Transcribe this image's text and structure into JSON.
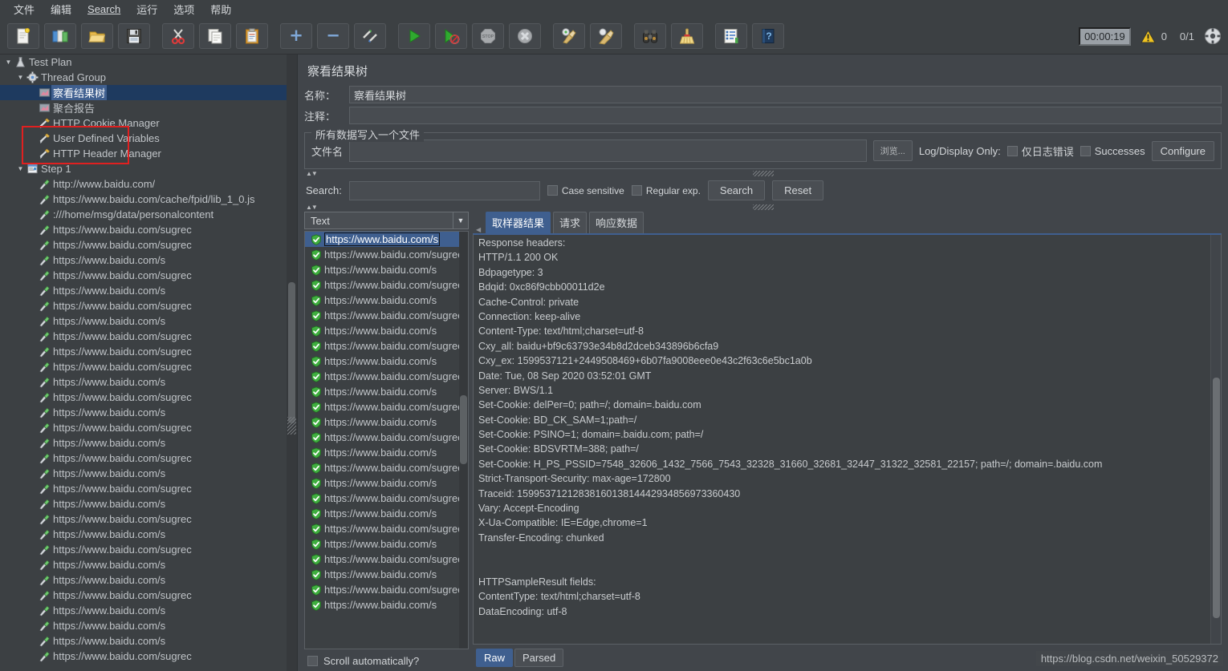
{
  "menu": {
    "items": [
      {
        "label": "文件",
        "name": "menu-file"
      },
      {
        "label": "编辑",
        "name": "menu-edit"
      },
      {
        "label": "Search",
        "name": "menu-search"
      },
      {
        "label": "运行",
        "name": "menu-run"
      },
      {
        "label": "选项",
        "name": "menu-options"
      },
      {
        "label": "帮助",
        "name": "menu-help"
      }
    ]
  },
  "toolbar": {
    "buttons": [
      {
        "icon": "new-document-icon",
        "name": "new-button"
      },
      {
        "icon": "open-templates-icon",
        "name": "templates-button"
      },
      {
        "icon": "open-folder-icon",
        "name": "open-button"
      },
      {
        "icon": "save-floppy-icon",
        "name": "save-button"
      },
      {
        "icon": "cut-scissors-icon",
        "name": "cut-button"
      },
      {
        "icon": "copy-icon",
        "name": "copy-button"
      },
      {
        "icon": "paste-clipboard-icon",
        "name": "paste-button"
      },
      {
        "icon": "plus-icon",
        "name": "expand-all-button"
      },
      {
        "icon": "minus-icon",
        "name": "collapse-all-button"
      },
      {
        "icon": "toggle-icon",
        "name": "toggle-button"
      },
      {
        "icon": "start-play-icon",
        "name": "start-button"
      },
      {
        "icon": "start-no-timers-icon",
        "name": "start-no-pauses-button"
      },
      {
        "icon": "stop-icon",
        "name": "stop-button"
      },
      {
        "icon": "shutdown-icon",
        "name": "shutdown-button"
      },
      {
        "icon": "clear-icon",
        "name": "clear-button"
      },
      {
        "icon": "clear-all-icon",
        "name": "clear-all-button"
      },
      {
        "icon": "binoculars-search-icon",
        "name": "search-tree-button"
      },
      {
        "icon": "broom-reset-icon",
        "name": "reset-search-button"
      },
      {
        "icon": "function-helper-icon",
        "name": "function-helper-button"
      },
      {
        "icon": "help-book-icon",
        "name": "help-button"
      }
    ],
    "status": {
      "timer": "00:00:19",
      "warning_icon": "warning-triangle-icon",
      "warning_count": "0",
      "thread_count": "0/1",
      "remote_icon": "thread-status-icon"
    }
  },
  "tree": {
    "nodes": [
      {
        "label": "Test Plan",
        "icon": "test-plan-icon",
        "depth": 0,
        "toggle": "down",
        "selected": false
      },
      {
        "label": "Thread Group",
        "icon": "thread-group-icon",
        "depth": 1,
        "toggle": "down",
        "selected": false
      },
      {
        "label": "察看结果树",
        "icon": "view-results-tree-icon",
        "depth": 2,
        "toggle": "none",
        "selected": true
      },
      {
        "label": "聚合报告",
        "icon": "aggregate-report-icon",
        "depth": 2,
        "toggle": "none",
        "selected": false
      },
      {
        "label": "HTTP Cookie Manager",
        "icon": "config-element-icon",
        "depth": 2,
        "toggle": "none",
        "selected": false
      },
      {
        "label": "User Defined Variables",
        "icon": "config-element-icon",
        "depth": 2,
        "toggle": "none",
        "selected": false
      },
      {
        "label": "HTTP Header Manager",
        "icon": "config-element-icon",
        "depth": 2,
        "toggle": "none",
        "selected": false
      },
      {
        "label": "Step 1",
        "icon": "transaction-controller-icon",
        "depth": 1,
        "toggle": "down",
        "selected": false
      },
      {
        "label": "http://www.baidu.com/",
        "icon": "http-sampler-icon",
        "depth": 2,
        "toggle": "none",
        "selected": false
      },
      {
        "label": "https://www.baidu.com/cache/fpid/lib_1_0.js",
        "icon": "http-sampler-icon",
        "depth": 2,
        "toggle": "none",
        "selected": false
      },
      {
        "label": ":///home/msg/data/personalcontent",
        "icon": "http-sampler-icon",
        "depth": 2,
        "toggle": "none",
        "selected": false
      },
      {
        "label": "https://www.baidu.com/sugrec",
        "icon": "http-sampler-icon",
        "depth": 2,
        "toggle": "none",
        "selected": false
      },
      {
        "label": "https://www.baidu.com/sugrec",
        "icon": "http-sampler-icon",
        "depth": 2,
        "toggle": "none",
        "selected": false
      },
      {
        "label": "https://www.baidu.com/s",
        "icon": "http-sampler-icon",
        "depth": 2,
        "toggle": "none",
        "selected": false
      },
      {
        "label": "https://www.baidu.com/sugrec",
        "icon": "http-sampler-icon",
        "depth": 2,
        "toggle": "none",
        "selected": false
      },
      {
        "label": "https://www.baidu.com/s",
        "icon": "http-sampler-icon",
        "depth": 2,
        "toggle": "none",
        "selected": false
      },
      {
        "label": "https://www.baidu.com/sugrec",
        "icon": "http-sampler-icon",
        "depth": 2,
        "toggle": "none",
        "selected": false
      },
      {
        "label": "https://www.baidu.com/s",
        "icon": "http-sampler-icon",
        "depth": 2,
        "toggle": "none",
        "selected": false
      },
      {
        "label": "https://www.baidu.com/sugrec",
        "icon": "http-sampler-icon",
        "depth": 2,
        "toggle": "none",
        "selected": false
      },
      {
        "label": "https://www.baidu.com/sugrec",
        "icon": "http-sampler-icon",
        "depth": 2,
        "toggle": "none",
        "selected": false
      },
      {
        "label": "https://www.baidu.com/sugrec",
        "icon": "http-sampler-icon",
        "depth": 2,
        "toggle": "none",
        "selected": false
      },
      {
        "label": "https://www.baidu.com/s",
        "icon": "http-sampler-icon",
        "depth": 2,
        "toggle": "none",
        "selected": false
      },
      {
        "label": "https://www.baidu.com/sugrec",
        "icon": "http-sampler-icon",
        "depth": 2,
        "toggle": "none",
        "selected": false
      },
      {
        "label": "https://www.baidu.com/s",
        "icon": "http-sampler-icon",
        "depth": 2,
        "toggle": "none",
        "selected": false
      },
      {
        "label": "https://www.baidu.com/sugrec",
        "icon": "http-sampler-icon",
        "depth": 2,
        "toggle": "none",
        "selected": false
      },
      {
        "label": "https://www.baidu.com/s",
        "icon": "http-sampler-icon",
        "depth": 2,
        "toggle": "none",
        "selected": false
      },
      {
        "label": "https://www.baidu.com/sugrec",
        "icon": "http-sampler-icon",
        "depth": 2,
        "toggle": "none",
        "selected": false
      },
      {
        "label": "https://www.baidu.com/s",
        "icon": "http-sampler-icon",
        "depth": 2,
        "toggle": "none",
        "selected": false
      },
      {
        "label": "https://www.baidu.com/sugrec",
        "icon": "http-sampler-icon",
        "depth": 2,
        "toggle": "none",
        "selected": false
      },
      {
        "label": "https://www.baidu.com/s",
        "icon": "http-sampler-icon",
        "depth": 2,
        "toggle": "none",
        "selected": false
      },
      {
        "label": "https://www.baidu.com/sugrec",
        "icon": "http-sampler-icon",
        "depth": 2,
        "toggle": "none",
        "selected": false
      },
      {
        "label": "https://www.baidu.com/s",
        "icon": "http-sampler-icon",
        "depth": 2,
        "toggle": "none",
        "selected": false
      },
      {
        "label": "https://www.baidu.com/sugrec",
        "icon": "http-sampler-icon",
        "depth": 2,
        "toggle": "none",
        "selected": false
      },
      {
        "label": "https://www.baidu.com/s",
        "icon": "http-sampler-icon",
        "depth": 2,
        "toggle": "none",
        "selected": false
      },
      {
        "label": "https://www.baidu.com/s",
        "icon": "http-sampler-icon",
        "depth": 2,
        "toggle": "none",
        "selected": false
      },
      {
        "label": "https://www.baidu.com/sugrec",
        "icon": "http-sampler-icon",
        "depth": 2,
        "toggle": "none",
        "selected": false
      },
      {
        "label": "https://www.baidu.com/s",
        "icon": "http-sampler-icon",
        "depth": 2,
        "toggle": "none",
        "selected": false
      },
      {
        "label": "https://www.baidu.com/s",
        "icon": "http-sampler-icon",
        "depth": 2,
        "toggle": "none",
        "selected": false
      },
      {
        "label": "https://www.baidu.com/s",
        "icon": "http-sampler-icon",
        "depth": 2,
        "toggle": "none",
        "selected": false
      },
      {
        "label": "https://www.baidu.com/sugrec",
        "icon": "http-sampler-icon",
        "depth": 2,
        "toggle": "none",
        "selected": false
      }
    ]
  },
  "panel": {
    "title": "察看结果树",
    "name_label": "名称：",
    "name_value": "察看结果树",
    "comment_label": "注释：",
    "comment_value": "",
    "file_group_title": "所有数据写入一个文件",
    "filename_label": "文件名",
    "filename_value": "",
    "browse_button": "浏览...",
    "log_display_only_label": "Log/Display Only:",
    "errors_only_label": "仅日志错误",
    "successes_label": "Successes",
    "configure_button": "Configure"
  },
  "search": {
    "label": "Search:",
    "value": "",
    "case_sensitive_label": "Case sensitive",
    "regular_exp_label": "Regular exp.",
    "search_button": "Search",
    "reset_button": "Reset"
  },
  "results": {
    "render_selected": "Text",
    "scroll_automatically_label": "Scroll automatically?",
    "samples": [
      {
        "label": "https://www.baidu.com/s",
        "status": "success",
        "selected": true
      },
      {
        "label": "https://www.baidu.com/sugrec",
        "status": "success",
        "selected": false
      },
      {
        "label": "https://www.baidu.com/s",
        "status": "success",
        "selected": false
      },
      {
        "label": "https://www.baidu.com/sugrec",
        "status": "success",
        "selected": false
      },
      {
        "label": "https://www.baidu.com/s",
        "status": "success",
        "selected": false
      },
      {
        "label": "https://www.baidu.com/sugrec",
        "status": "success",
        "selected": false
      },
      {
        "label": "https://www.baidu.com/s",
        "status": "success",
        "selected": false
      },
      {
        "label": "https://www.baidu.com/sugrec",
        "status": "success",
        "selected": false
      },
      {
        "label": "https://www.baidu.com/s",
        "status": "success",
        "selected": false
      },
      {
        "label": "https://www.baidu.com/sugrec",
        "status": "success",
        "selected": false
      },
      {
        "label": "https://www.baidu.com/s",
        "status": "success",
        "selected": false
      },
      {
        "label": "https://www.baidu.com/sugrec",
        "status": "success",
        "selected": false
      },
      {
        "label": "https://www.baidu.com/s",
        "status": "success",
        "selected": false
      },
      {
        "label": "https://www.baidu.com/sugrec",
        "status": "success",
        "selected": false
      },
      {
        "label": "https://www.baidu.com/s",
        "status": "success",
        "selected": false
      },
      {
        "label": "https://www.baidu.com/sugrec",
        "status": "success",
        "selected": false
      },
      {
        "label": "https://www.baidu.com/s",
        "status": "success",
        "selected": false
      },
      {
        "label": "https://www.baidu.com/sugrec",
        "status": "success",
        "selected": false
      },
      {
        "label": "https://www.baidu.com/s",
        "status": "success",
        "selected": false
      },
      {
        "label": "https://www.baidu.com/sugrec",
        "status": "success",
        "selected": false
      },
      {
        "label": "https://www.baidu.com/s",
        "status": "success",
        "selected": false
      },
      {
        "label": "https://www.baidu.com/sugrec",
        "status": "success",
        "selected": false
      },
      {
        "label": "https://www.baidu.com/s",
        "status": "success",
        "selected": false
      },
      {
        "label": "https://www.baidu.com/sugrec",
        "status": "success",
        "selected": false
      },
      {
        "label": "https://www.baidu.com/s",
        "status": "success",
        "selected": false
      }
    ],
    "tabs": [
      {
        "label": "取样器结果",
        "active": true,
        "name": "tab-sampler-result"
      },
      {
        "label": "请求",
        "active": false,
        "name": "tab-request"
      },
      {
        "label": "响应数据",
        "active": false,
        "name": "tab-response-data"
      }
    ],
    "view_tabs": [
      {
        "label": "Raw",
        "active": true,
        "name": "raw-view-tab"
      },
      {
        "label": "Parsed",
        "active": false,
        "name": "parsed-view-tab"
      }
    ],
    "response_lines": [
      "Response headers:",
      "HTTP/1.1 200 OK",
      "Bdpagetype: 3",
      "Bdqid: 0xc86f9cbb00011d2e",
      "Cache-Control: private",
      "Connection: keep-alive",
      "Content-Type: text/html;charset=utf-8",
      "Cxy_all: baidu+bf9c63793e34b8d2dceb343896b6cfa9",
      "Cxy_ex: 1599537121+2449508469+6b07fa9008eee0e43c2f63c6e5bc1a0b",
      "Date: Tue, 08 Sep 2020 03:52:01 GMT",
      "Server: BWS/1.1",
      "Set-Cookie: delPer=0; path=/; domain=.baidu.com",
      "Set-Cookie: BD_CK_SAM=1;path=/",
      "Set-Cookie: PSINO=1; domain=.baidu.com; path=/",
      "Set-Cookie: BDSVRTM=388; path=/",
      "Set-Cookie: H_PS_PSSID=7548_32606_1432_7566_7543_32328_31660_32681_32447_31322_32581_22157; path=/; domain=.baidu.com",
      "Strict-Transport-Security: max-age=172800",
      "Traceid: 1599537121283816013814442934856973360430",
      "Vary: Accept-Encoding",
      "X-Ua-Compatible: IE=Edge,chrome=1",
      "Transfer-Encoding: chunked",
      "",
      "",
      "HTTPSampleResult fields:",
      "ContentType: text/html;charset=utf-8",
      "DataEncoding: utf-8"
    ]
  },
  "watermark": "https://blog.csdn.net/weixin_50529372",
  "colors": {
    "accent_blue": "#3f5f8f",
    "annotation_red": "#e02020",
    "window_bg": "#3c4043",
    "panel_bg": "#41454a",
    "success_green": "#3fae3f"
  }
}
